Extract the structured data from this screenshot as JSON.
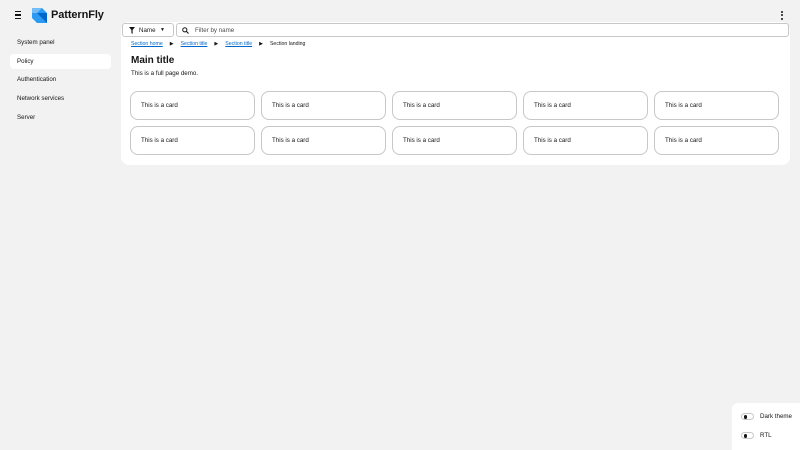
{
  "masthead": {
    "logo_text": "PatternFly",
    "menu_icon": "hamburger-icon",
    "kebab_icon": "kebab-icon"
  },
  "sidebar": {
    "items": [
      {
        "label": "System panel",
        "active": false
      },
      {
        "label": "Policy",
        "active": true
      },
      {
        "label": "Authentication",
        "active": false
      },
      {
        "label": "Network services",
        "active": false
      },
      {
        "label": "Server",
        "active": false
      }
    ]
  },
  "toolbar": {
    "filter_label": "Name",
    "search_placeholder": "Filter by name",
    "search_value": ""
  },
  "breadcrumb": {
    "items": [
      "Section home",
      "Section title",
      "Section title"
    ],
    "current": "Section landing"
  },
  "page": {
    "title": "Main title",
    "description": "This is a full page demo."
  },
  "cards": [
    "This is a card",
    "This is a card",
    "This is a card",
    "This is a card",
    "This is a card",
    "This is a card",
    "This is a card",
    "This is a card",
    "This is a card",
    "This is a card"
  ],
  "theme_panel": {
    "dark_theme_label": "Dark theme",
    "rtl_label": "RTL"
  },
  "colors": {
    "link": "#0066cc",
    "background": "#f2f2f2",
    "surface": "#ffffff",
    "border": "#c7c7c7",
    "logo_blue": "#2b9af3"
  }
}
